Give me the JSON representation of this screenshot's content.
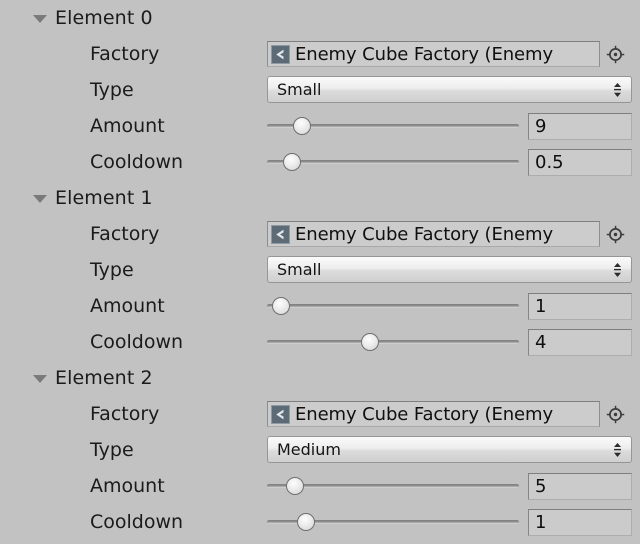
{
  "panel": {
    "background_color": "#c2c2c2",
    "object_picker_icon": "target-icon",
    "asset_icon": "unity-prefab-icon",
    "foldout_icon": "triangle-down-icon",
    "dropdown_icon": "updown-arrows-icon"
  },
  "labels": {
    "factory": "Factory",
    "type": "Type",
    "amount": "Amount",
    "cooldown": "Cooldown"
  },
  "elements": [
    {
      "header": "Element 0",
      "factory": "Enemy Cube Factory (Enemy",
      "type": "Small",
      "amount": "9",
      "amount_fill": 11,
      "cooldown": "0.5",
      "cooldown_fill": 7
    },
    {
      "header": "Element 1",
      "factory": "Enemy Cube Factory (Enemy",
      "type": "Small",
      "amount": "1",
      "amount_fill": 2,
      "cooldown": "4",
      "cooldown_fill": 40
    },
    {
      "header": "Element 2",
      "factory": "Enemy Cube Factory (Enemy",
      "type": "Medium",
      "amount": "5",
      "amount_fill": 8,
      "cooldown": "1",
      "cooldown_fill": 13
    }
  ]
}
